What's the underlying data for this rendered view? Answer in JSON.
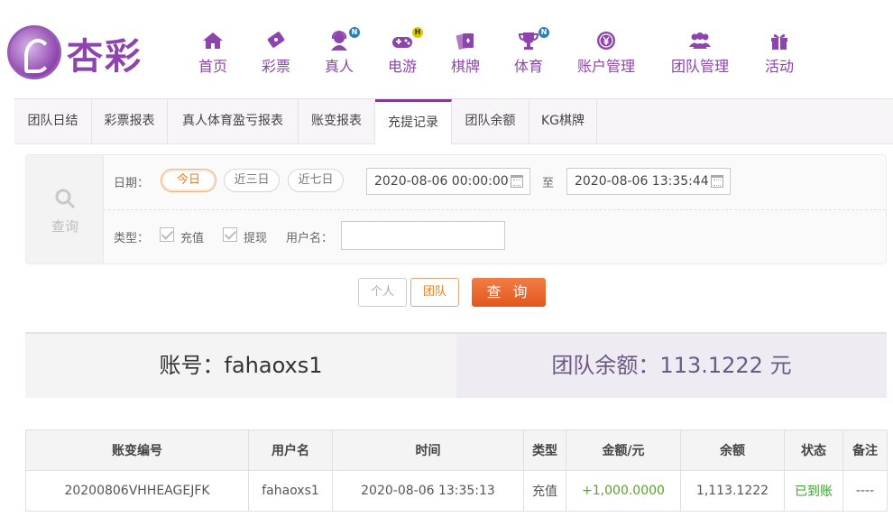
{
  "brand": {
    "logo_text": "杏彩"
  },
  "nav": [
    {
      "label": "首页",
      "icon": "home-icon"
    },
    {
      "label": "彩票",
      "icon": "lottery-ticket-icon"
    },
    {
      "label": "真人",
      "icon": "live-dealer-icon",
      "badge": "N"
    },
    {
      "label": "电游",
      "icon": "gamepad-icon",
      "badge": "H"
    },
    {
      "label": "棋牌",
      "icon": "playing-cards-icon"
    },
    {
      "label": "体育",
      "icon": "trophy-icon",
      "badge": "N"
    },
    {
      "label": "账户管理",
      "icon": "account-yen-icon"
    },
    {
      "label": "团队管理",
      "icon": "team-users-icon"
    },
    {
      "label": "活动",
      "icon": "gift-icon"
    }
  ],
  "tabs": [
    "团队日结",
    "彩票报表",
    "真人体育盈亏报表",
    "账变报表",
    "充提记录",
    "团队余额",
    "KG棋牌"
  ],
  "active_tab": "充提记录",
  "filter": {
    "side_label": "查询",
    "date_label": "日期：",
    "quick_dates": [
      "今日",
      "近三日",
      "近七日"
    ],
    "selected_quick_date": "今日",
    "start_datetime": "2020-08-06 00:00:00",
    "range_separator": "至",
    "end_datetime": "2020-08-06 13:35:44",
    "type_label": "类型：",
    "type_options": [
      "充值",
      "提现"
    ],
    "username_label": "用户名：",
    "username_value": ""
  },
  "buttons": {
    "personal": "个人",
    "team": "团队",
    "query": "查 询"
  },
  "summary": {
    "account_text": "账号：fahaoxs1",
    "team_balance_text": "团队余额：113.1222 元"
  },
  "table": {
    "headers": [
      "账变编号",
      "用户名",
      "时间",
      "类型",
      "金额/元",
      "余额",
      "状态",
      "备注"
    ],
    "rows": [
      [
        "20200806VHHEAGEJFK",
        "fahaoxs1",
        "2020-08-06 13:35:13",
        "充值",
        "+1,000.0000",
        "1,113.1222",
        "已到账",
        "----"
      ]
    ]
  },
  "colors": {
    "brand_purple": "#8e44ad",
    "accent_orange": "#e67e22",
    "query_button": "#e85a21",
    "positive_green": "#5aa02c"
  }
}
